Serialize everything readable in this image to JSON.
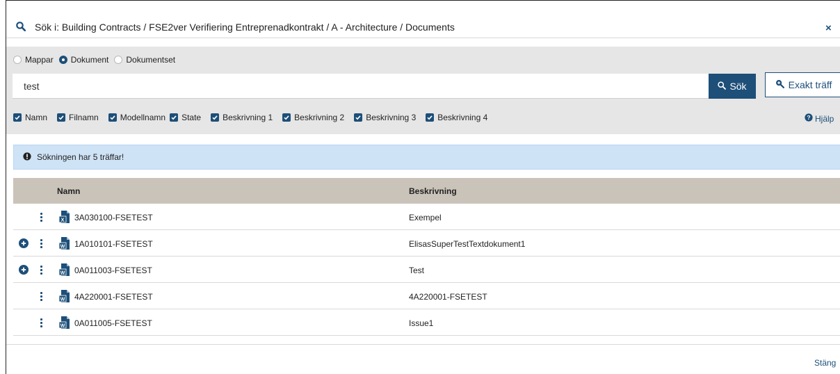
{
  "header": {
    "title": "Sök i: Building Contracts / FSE2ver Verifiering Entreprenadkontrakt / A - Architecture / Documents",
    "close_glyph": "×"
  },
  "scope": {
    "options": [
      {
        "label": "Mappar",
        "selected": false
      },
      {
        "label": "Dokument",
        "selected": true
      },
      {
        "label": "Dokumentset",
        "selected": false
      }
    ]
  },
  "search": {
    "value": "test",
    "button_label": "Sök",
    "exact_label": "Exakt träff"
  },
  "fields": [
    {
      "label": "Namn",
      "checked": true
    },
    {
      "label": "Filnamn",
      "checked": true
    },
    {
      "label": "Modellnamn",
      "checked": true
    },
    {
      "label": "State",
      "checked": true
    },
    {
      "label": "Beskrivning 1",
      "checked": true
    },
    {
      "label": "Beskrivning 2",
      "checked": true
    },
    {
      "label": "Beskrivning 3",
      "checked": true
    },
    {
      "label": "Beskrivning 4",
      "checked": true
    }
  ],
  "help_label": "Hjälp",
  "alert": {
    "text": "Sökningen har 5 träffar!"
  },
  "table": {
    "headers": {
      "name": "Namn",
      "description": "Beskrivning"
    },
    "rows": [
      {
        "name": "3A030100-FSETEST",
        "description": "Exempel",
        "file_type": "excel",
        "expandable": false
      },
      {
        "name": "1A010101-FSETEST",
        "description": "ElisasSuperTestTextdokument1",
        "file_type": "word",
        "expandable": true
      },
      {
        "name": "0A011003-FSETEST",
        "description": "Test",
        "file_type": "word",
        "expandable": true
      },
      {
        "name": "4A220001-FSETEST",
        "description": "4A220001-FSETEST",
        "file_type": "word",
        "expandable": false
      },
      {
        "name": "0A011005-FSETEST",
        "description": "Issue1",
        "file_type": "word",
        "expandable": false
      }
    ]
  },
  "footer": {
    "close_label": "Stäng"
  },
  "colors": {
    "accent": "#1d4f79",
    "alert_bg": "#cfe3f6",
    "table_header_bg": "#cac3ba",
    "filter_bg": "#e6e6e6"
  }
}
